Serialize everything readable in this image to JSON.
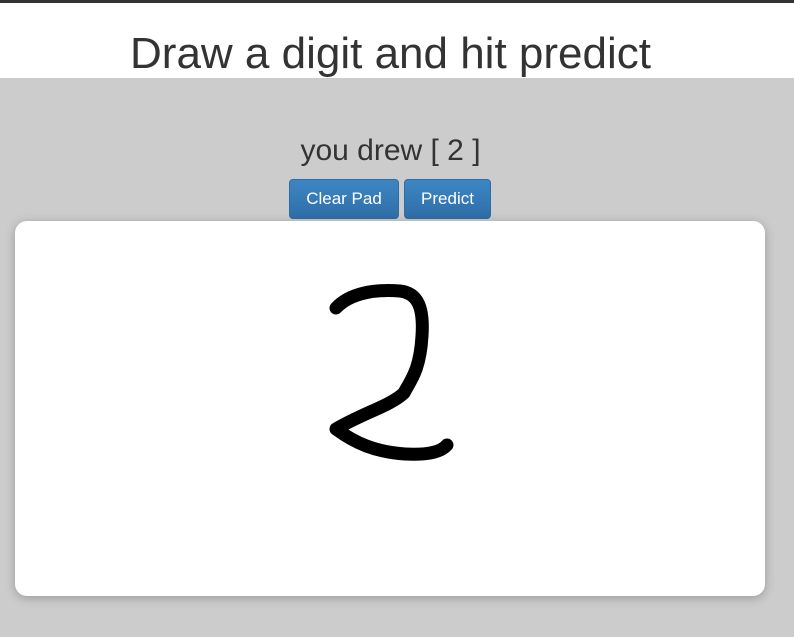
{
  "header": {
    "title": "Draw a digit and hit predict"
  },
  "prediction": {
    "text": "you drew [ 2 ]"
  },
  "controls": {
    "clear_label": "Clear Pad",
    "predict_label": "Predict"
  },
  "drawing_pad": {
    "stroke_icon": "handwritten-digit-stroke",
    "ink_color": "#000000"
  },
  "colors": {
    "accent": "#337ab7",
    "background": "#cccccc",
    "pad": "#ffffff"
  }
}
